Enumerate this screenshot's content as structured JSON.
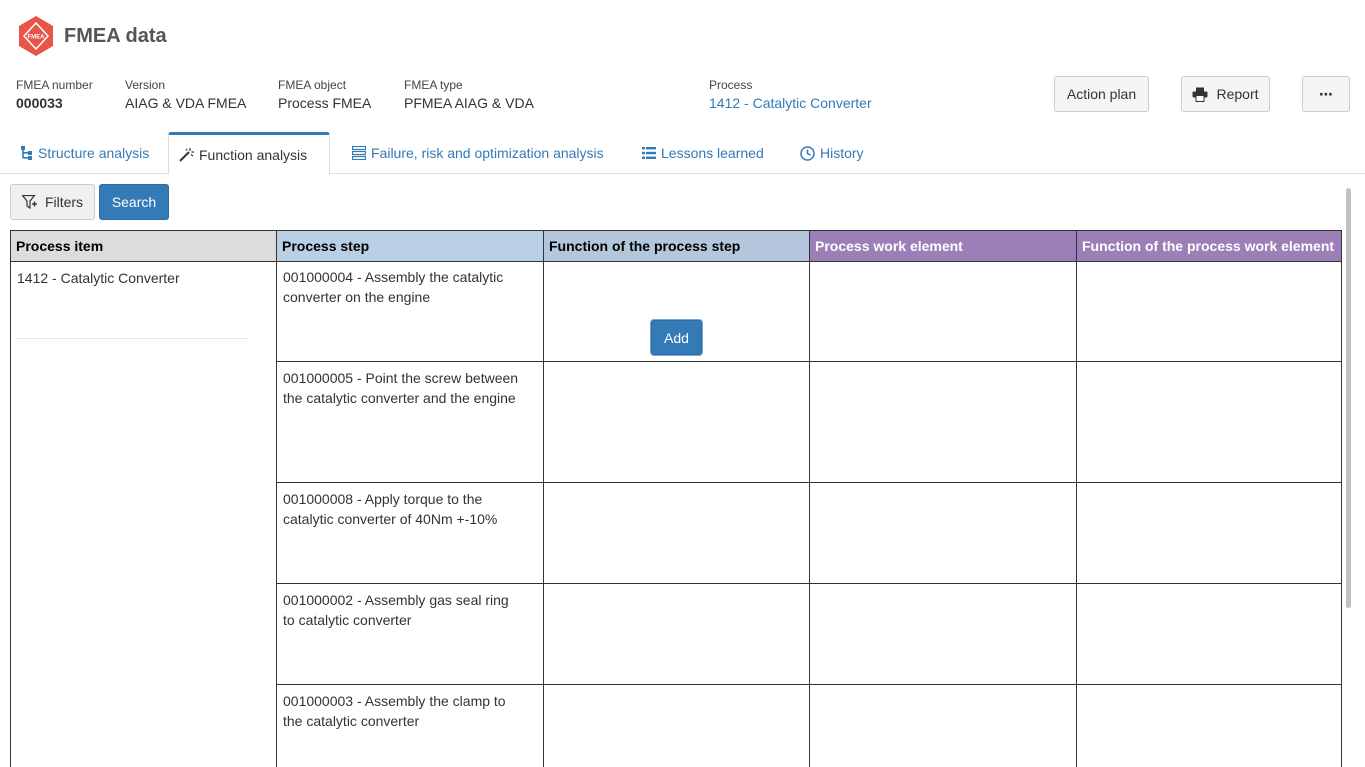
{
  "app": {
    "title": "FMEA data",
    "logo_text": "FMEA"
  },
  "meta": {
    "fmea_number": {
      "label": "FMEA number",
      "value": "000033"
    },
    "version": {
      "label": "Version",
      "value": "AIAG & VDA FMEA"
    },
    "fmea_object": {
      "label": "FMEA object",
      "value": "Process FMEA"
    },
    "fmea_type": {
      "label": "FMEA type",
      "value": "PFMEA AIAG & VDA"
    },
    "process": {
      "label": "Process",
      "value": "1412 - Catalytic Converter"
    }
  },
  "actions": {
    "action_plan": "Action plan",
    "report": "Report",
    "more": "⋯"
  },
  "tabs": [
    {
      "label": "Structure analysis",
      "icon": "structure-icon"
    },
    {
      "label": "Function analysis",
      "icon": "wand-icon",
      "active": true
    },
    {
      "label": "Failure, risk and optimization analysis",
      "icon": "list-grid-icon"
    },
    {
      "label": "Lessons learned",
      "icon": "list-icon"
    },
    {
      "label": "History",
      "icon": "clock-icon"
    }
  ],
  "toolbar": {
    "filters": "Filters",
    "search": "Search"
  },
  "grid": {
    "headers": [
      "Process item",
      "Process step",
      "Function of the process step",
      "Process work element",
      "Function of the process work element"
    ],
    "header_colors": [
      "#dcdcdc",
      "#b8cfe6",
      "#b4c6dc",
      "#9b7fb6",
      "#9b7fb6"
    ],
    "process_item": "1412 - Catalytic Converter",
    "add_label": "Add",
    "steps": [
      "001000004 - Assembly the catalytic converter on the engine",
      "001000005 - Point the screw between the catalytic converter and the engine",
      "001000008 - Apply torque to the catalytic converter of 40Nm +-10%",
      "001000002 - Assembly gas seal ring to catalytic converter",
      "001000003 - Assembly the clamp to the catalytic converter"
    ]
  }
}
